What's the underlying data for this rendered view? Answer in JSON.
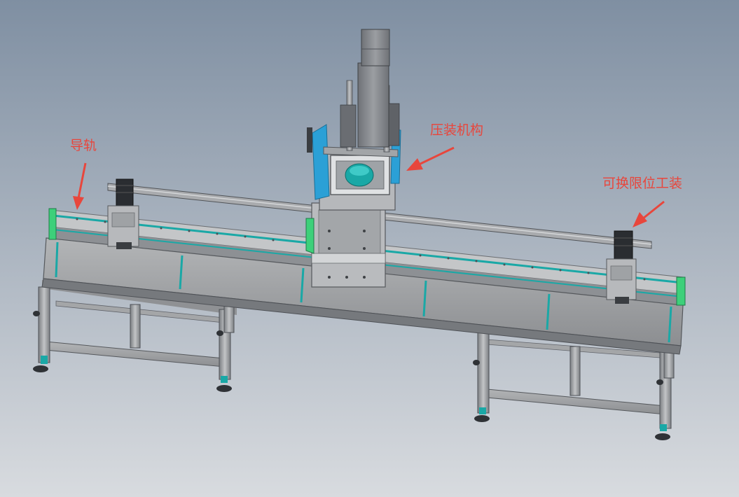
{
  "colors": {
    "bg_top": "#7f8fa2",
    "bg_bottom": "#d6d9dd",
    "frame_gray": "#9a9c9e",
    "frame_dark": "#5e6166",
    "accent_teal": "#1aa8a6",
    "accent_blue": "#2ba0d6",
    "annotation_red": "#e8463c"
  },
  "annotations": {
    "guide_rail": "导轨",
    "press_mechanism": "压装机构",
    "limit_fixture": "可换限位工装"
  },
  "icons": {
    "guide_rail_arrow": "arrow-icon",
    "press_arrow": "arrow-icon",
    "fixture_arrow": "arrow-icon"
  }
}
